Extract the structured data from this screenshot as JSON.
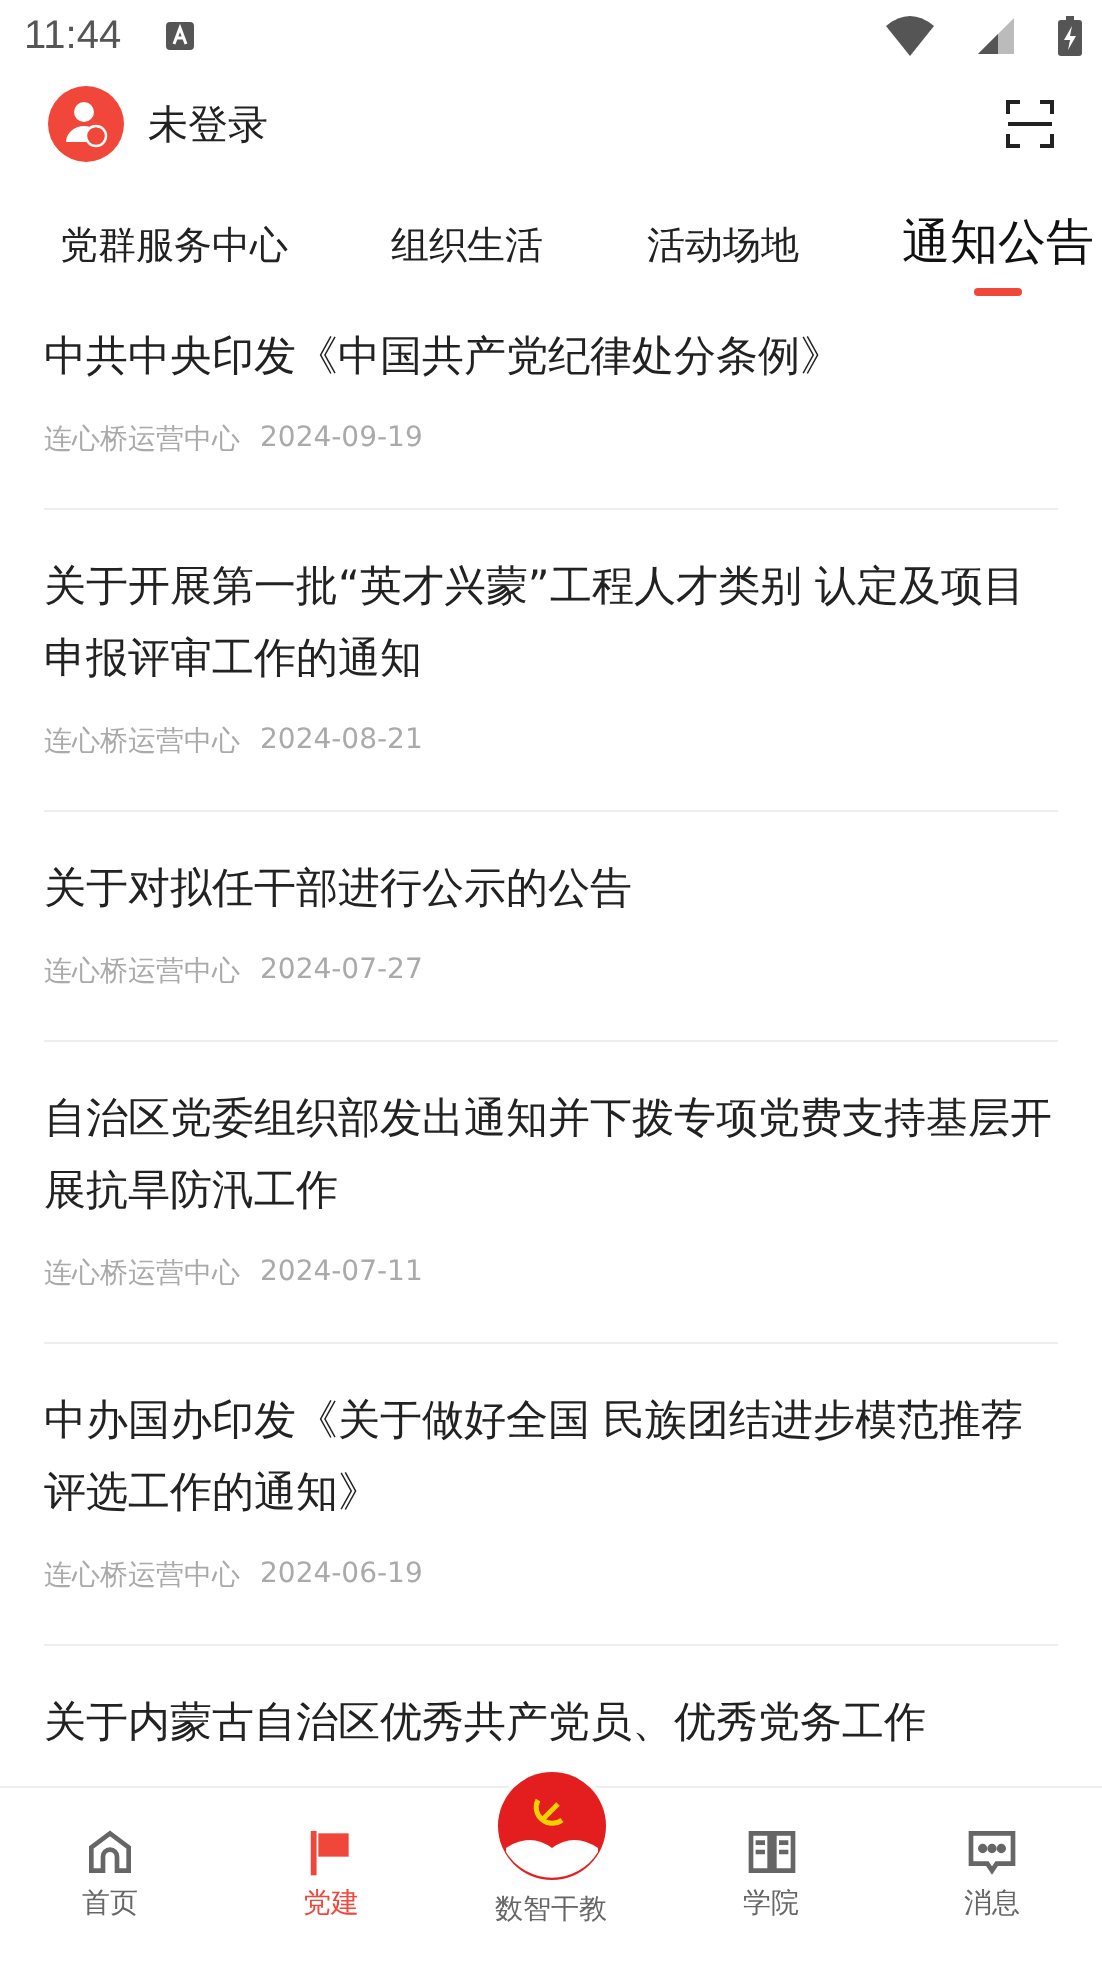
{
  "status_bar": {
    "time": "11:44"
  },
  "header": {
    "user_label": "未登录"
  },
  "tabs": [
    {
      "label": "党群服务中心",
      "selected": false
    },
    {
      "label": "组织生活",
      "selected": false
    },
    {
      "label": "活动场地",
      "selected": false
    },
    {
      "label": "通知公告",
      "selected": true
    }
  ],
  "articles": [
    {
      "title": "中共中央印发《中国共产党纪律处分条例》",
      "source": "连心桥运营中心",
      "date": "2024-09-19"
    },
    {
      "title": "关于开展第一批“英才兴蒙”工程人才类别 认定及项目申报评审工作的通知",
      "source": "连心桥运营中心",
      "date": "2024-08-21"
    },
    {
      "title": "关于对拟任干部进行公示的公告",
      "source": "连心桥运营中心",
      "date": "2024-07-27"
    },
    {
      "title": "自治区党委组织部发出通知并下拨专项党费支持基层开展抗旱防汛工作",
      "source": "连心桥运营中心",
      "date": "2024-07-11"
    },
    {
      "title": "中办国办印发《关于做好全国 民族团结进步模范推荐评选工作的通知》",
      "source": "连心桥运营中心",
      "date": "2024-06-19"
    },
    {
      "title": "关于内蒙古自治区优秀共产党员、优秀党务工作"
    }
  ],
  "bottom_nav": [
    {
      "kind": "home",
      "label": "首页",
      "selected": false
    },
    {
      "kind": "flag",
      "label": "党建",
      "selected": true
    },
    {
      "kind": "logo",
      "label": "数智干教",
      "selected": false
    },
    {
      "kind": "book",
      "label": "学院",
      "selected": false
    },
    {
      "kind": "chat",
      "label": "消息",
      "selected": false
    }
  ]
}
